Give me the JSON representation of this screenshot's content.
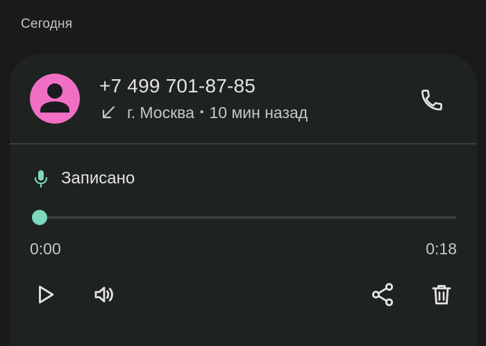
{
  "section": {
    "title": "Сегодня"
  },
  "call": {
    "number": "+7 499 701-87-85",
    "direction_icon": "incoming-call-arrow-icon",
    "location": "г. Москва",
    "separator": "•",
    "time_ago": "10 мин назад"
  },
  "recording": {
    "label": "Записано",
    "progress": 0.0,
    "time_current": "0:00",
    "time_total": "0:18"
  },
  "colors": {
    "avatar": "#f06fc4",
    "accent": "#7ed8bd",
    "background": "#191a19",
    "card": "#1e2220"
  },
  "icons": {
    "avatar": "person-icon",
    "call": "phone-icon",
    "mic": "mic-icon",
    "play": "play-icon",
    "speaker": "speaker-icon",
    "share": "share-icon",
    "delete": "trash-icon"
  }
}
